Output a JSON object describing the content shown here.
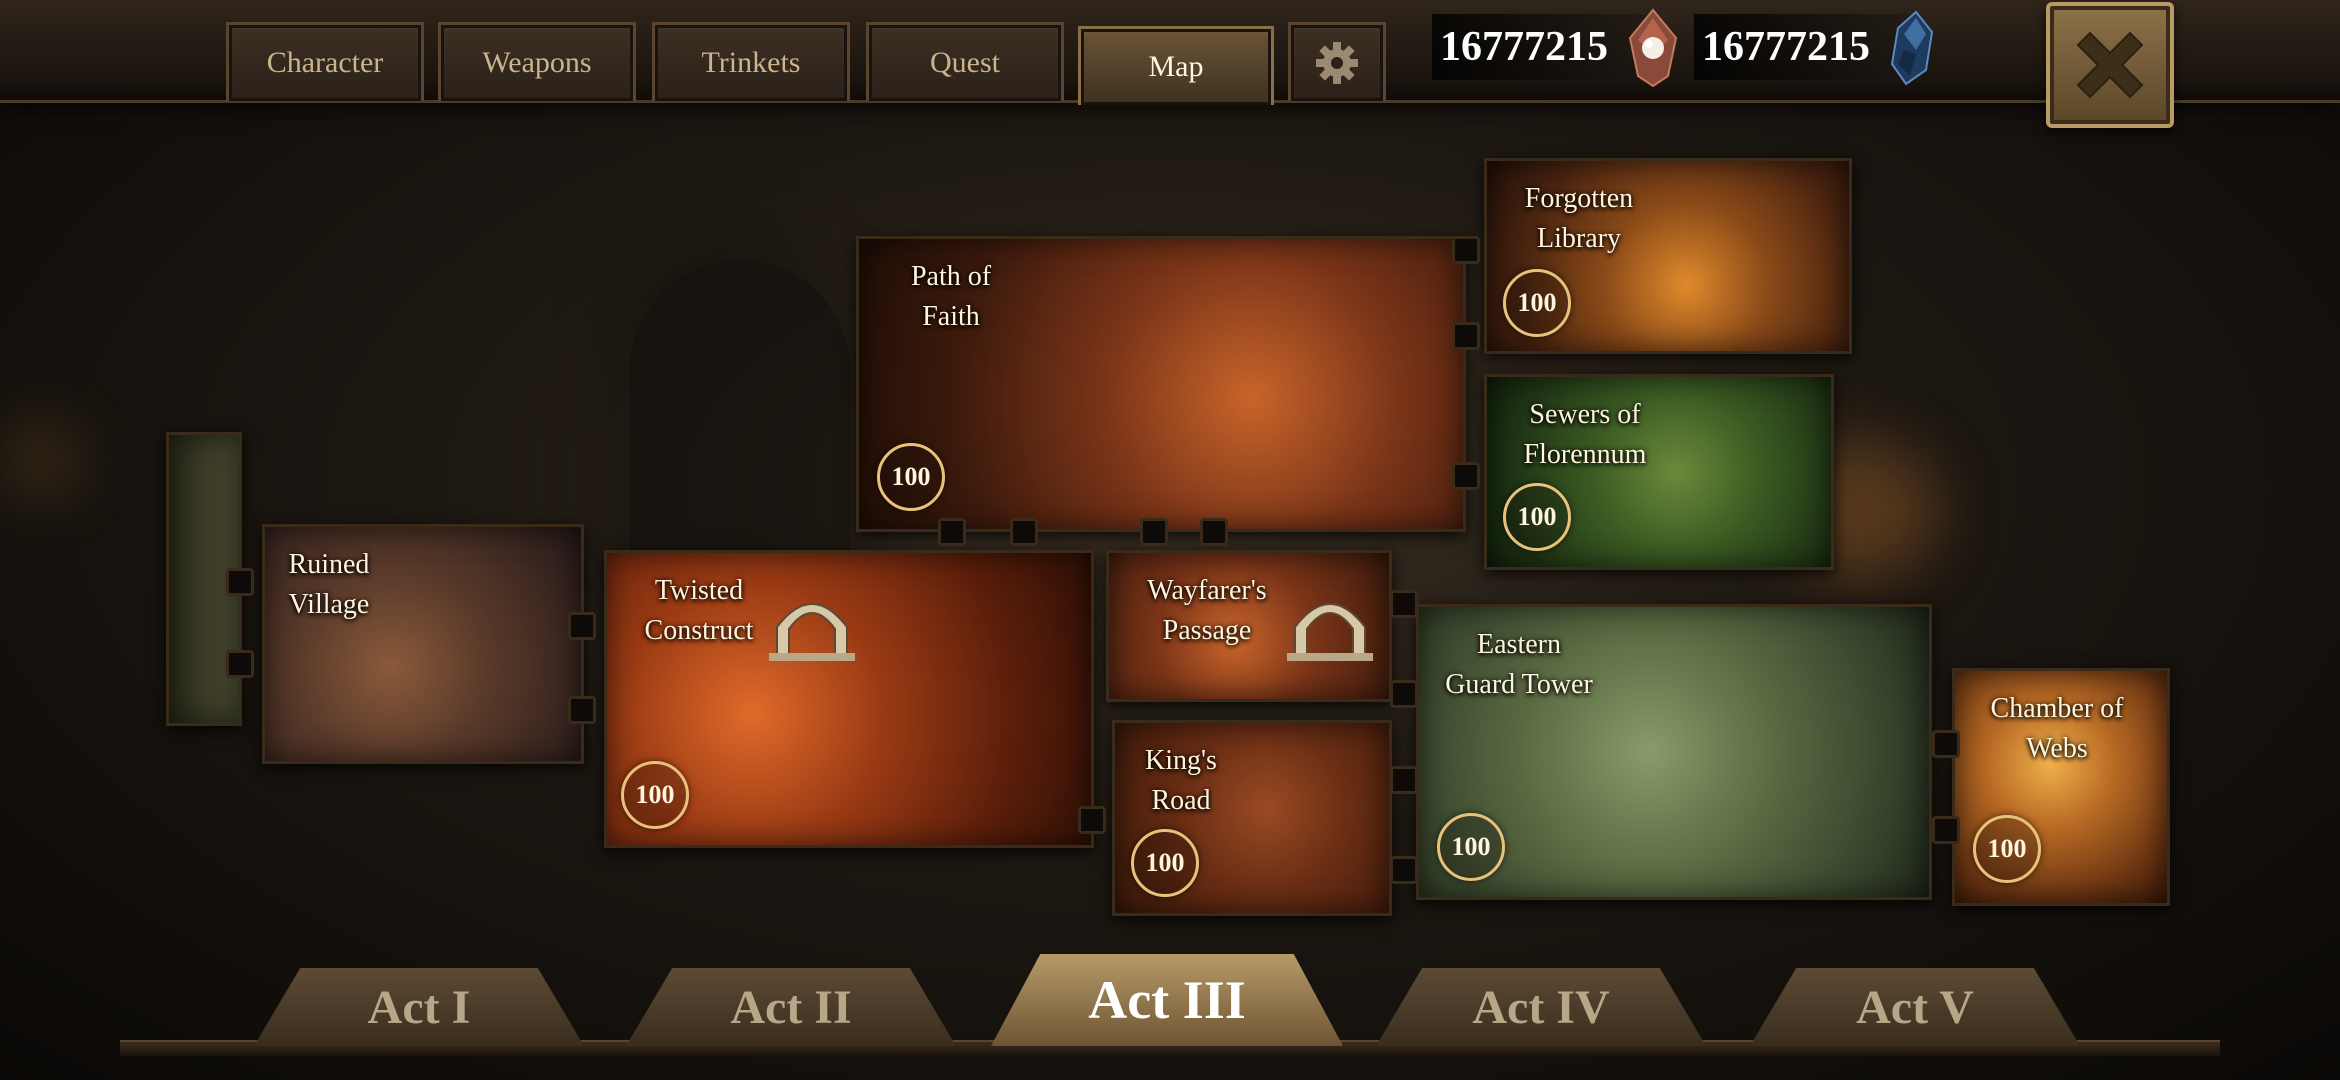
{
  "header": {
    "tabs": [
      {
        "label": "Character"
      },
      {
        "label": "Weapons"
      },
      {
        "label": "Trinkets"
      },
      {
        "label": "Quest"
      },
      {
        "label": "Map"
      }
    ],
    "active_tab": "Map",
    "settings_icon": "gear-icon",
    "close_icon": "close-icon"
  },
  "currency": {
    "pearls": {
      "value": "16777215",
      "icon": "pearl-gem-icon"
    },
    "crystals": {
      "value": "16777215",
      "icon": "blue-crystal-icon"
    }
  },
  "map": {
    "locations": [
      {
        "name_line1": "Path of",
        "name_line2": "Faith",
        "progress": "100"
      },
      {
        "name_line1": "Forgotten",
        "name_line2": "Library",
        "progress": "100"
      },
      {
        "name_line1": "Sewers of",
        "name_line2": "Florennum",
        "progress": "100"
      },
      {
        "name_line1": "Ruined",
        "name_line2": "Village",
        "progress": ""
      },
      {
        "name_line1": "Twisted",
        "name_line2": "Construct",
        "progress": "100"
      },
      {
        "name_line1": "Wayfarer's",
        "name_line2": "Passage",
        "progress": ""
      },
      {
        "name_line1": "King's",
        "name_line2": "Road",
        "progress": "100"
      },
      {
        "name_line1": "Eastern",
        "name_line2": "Guard Tower",
        "progress": "100"
      },
      {
        "name_line1": "Chamber of",
        "name_line2": "Webs",
        "progress": "100"
      }
    ]
  },
  "acts": [
    {
      "label": "Act I"
    },
    {
      "label": "Act II"
    },
    {
      "label": "Act III"
    },
    {
      "label": "Act IV"
    },
    {
      "label": "Act V"
    }
  ],
  "active_act": "Act III",
  "colors": {
    "accent_gold": "#e8c27a",
    "frame_brown": "#3a2a1a"
  }
}
